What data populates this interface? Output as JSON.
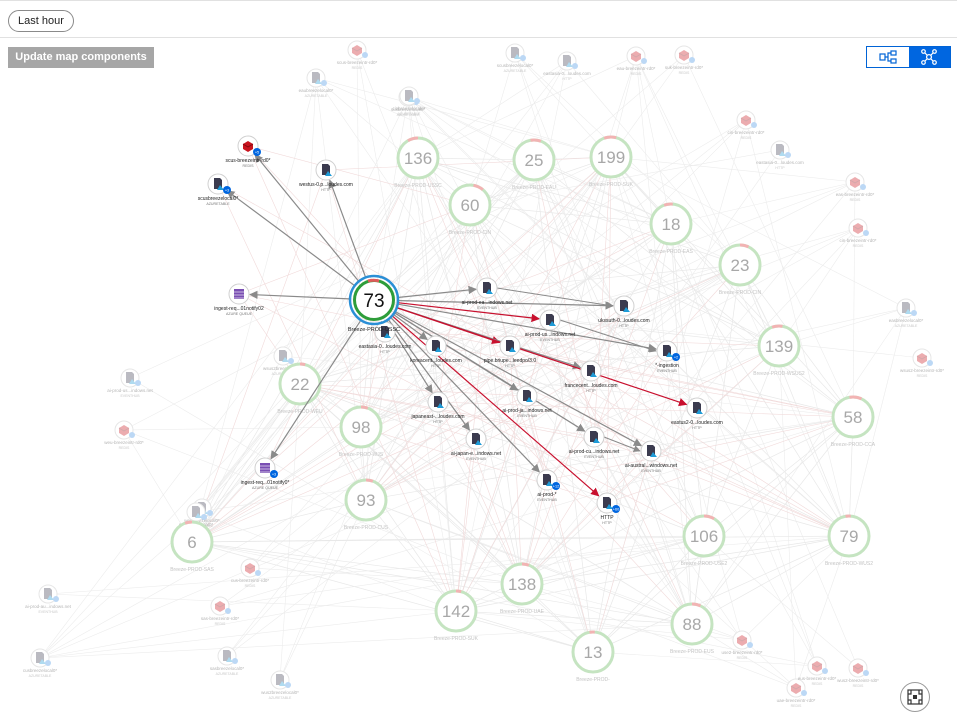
{
  "toolbar": {
    "time_range": "Last hour",
    "update_button": "Update map components"
  },
  "colors": {
    "accent": "#0066e0",
    "healthy": "#2e9d3a",
    "faded_ring": "#c5e4c1",
    "alert_arc": "#e05a5a",
    "error_edge": "#c8102e",
    "edge": "#8a8a8a"
  },
  "focus": {
    "count": "73",
    "label": "Breeze-PROD-USSC"
  },
  "clusters": [
    {
      "count": "136",
      "label": "Breeze-PROD-USSC"
    },
    {
      "count": "25",
      "label": "Breeze-PROD-EAU"
    },
    {
      "count": "199",
      "label": "Breeze-PROD-SUK"
    },
    {
      "count": "60",
      "label": "Breeze-PROD-CIN"
    },
    {
      "count": "18",
      "label": "Breeze-PROD-EAS"
    },
    {
      "count": "23",
      "label": "Breeze-PROD-CIN"
    },
    {
      "count": "139",
      "label": "Breeze-PROD-WSUS2"
    },
    {
      "count": "22",
      "label": "Breeze-PROD-WEU"
    },
    {
      "count": "98",
      "label": "Breeze-PROD-WJS"
    },
    {
      "count": "58",
      "label": "Breeze-PROD-CCA"
    },
    {
      "count": "93",
      "label": "Breeze-PROD-CUS"
    },
    {
      "count": "6",
      "label": "Breeze-PROD-SAS"
    },
    {
      "count": "106",
      "label": "Breeze-PROD-USE2"
    },
    {
      "count": "79",
      "label": "Breeze-PROD-WUS2"
    },
    {
      "count": "138",
      "label": "Breeze-PROD-UAE"
    },
    {
      "count": "142",
      "label": "Breeze-PROD-SUK"
    },
    {
      "count": "88",
      "label": "Breeze-PROD-EUS"
    },
    {
      "count": "13",
      "label": "Breeze-PROD-"
    }
  ],
  "deps": [
    {
      "icon": "redis",
      "badge": "+5",
      "name": "scus-breezeintr-rd0*",
      "type": "REDIS"
    },
    {
      "icon": "doc",
      "badge": "+3",
      "name": "scusbreezelocal0*",
      "type": "AZURETABLE"
    },
    {
      "icon": "doc",
      "badge": "",
      "name": "westus-0.p...loudes.com",
      "type": "HTTP"
    },
    {
      "icon": "queue",
      "badge": "",
      "name": "ingest-req...01notify02",
      "type": "AZURE QUEUE"
    },
    {
      "icon": "doc",
      "badge": "",
      "name": "ai-prod-ea...indows.net",
      "type": "EVENTHUB"
    },
    {
      "icon": "doc",
      "badge": "",
      "name": "ukssuth-0...loudes.com",
      "type": "HTTP"
    },
    {
      "icon": "doc",
      "badge": "",
      "name": "eastasia-0...loudes.com",
      "type": "HTTP"
    },
    {
      "icon": "doc",
      "badge": "",
      "name": "ai-prod-us...indows.net",
      "type": "EVENTHUB"
    },
    {
      "icon": "doc",
      "badge": "+2",
      "name": "*-ingestion",
      "type": "EVENTHUB"
    },
    {
      "icon": "doc",
      "badge": "",
      "name": "koreacent...loudes.com",
      "type": "HTTP"
    },
    {
      "icon": "doc",
      "badge": "",
      "name": "pipe.briupe...leedpo/3.0",
      "type": "HTTP"
    },
    {
      "icon": "doc",
      "badge": "",
      "name": "francecent...loudes.com",
      "type": "HTTP"
    },
    {
      "icon": "doc",
      "badge": "",
      "name": "ai-prod-ja...indows.net",
      "type": "EVENTHUB"
    },
    {
      "icon": "doc",
      "badge": "",
      "name": "japaneast-...loudes.com",
      "type": "HTTP"
    },
    {
      "icon": "doc",
      "badge": "",
      "name": "eastus2-0...loudes.com",
      "type": "HTTP"
    },
    {
      "icon": "doc",
      "badge": "",
      "name": "ai-prod-cu...indows.net",
      "type": "EVENTHUB"
    },
    {
      "icon": "doc",
      "badge": "",
      "name": "ai-japan-e...indows.net",
      "type": "EVENTHUB"
    },
    {
      "icon": "doc",
      "badge": "",
      "name": "ai-austral...windows.net",
      "type": "EVENTHUB"
    },
    {
      "icon": "queue",
      "badge": "+3",
      "name": "ingest-req...01notify0*",
      "type": "AZURE QUEUE"
    },
    {
      "icon": "doc",
      "badge": "+12",
      "name": "ai-prod-*",
      "type": "EVENTHUB"
    },
    {
      "icon": "doc",
      "badge": "+60",
      "name": "HTTP",
      "type": "HTTP"
    }
  ],
  "ghosts": [
    {
      "icon": "redis",
      "name": "scus-breezeintr-rd0*",
      "type": "REDIS"
    },
    {
      "icon": "doc",
      "name": "scusbreezelocal0*",
      "type": "AZURETABLE"
    },
    {
      "icon": "doc",
      "name": "eastasia-0...loudes.com",
      "type": "HTTP"
    },
    {
      "icon": "redis",
      "name": "eau-breezeintr-rd0*",
      "type": "REDIS"
    },
    {
      "icon": "redis",
      "name": "suk-breezeintr-rd0*",
      "type": "REDIS"
    },
    {
      "icon": "doc",
      "name": "eaubreezelocal0*",
      "type": "AZURETABLE"
    },
    {
      "icon": "doc",
      "name": "sukbreezelocal0*",
      "type": "AZURETABLE"
    },
    {
      "icon": "doc",
      "name": "cinbreezelocal0*",
      "type": "AZURETABLE"
    },
    {
      "icon": "redis",
      "name": "cin-breezeintr-rd0*",
      "type": "REDIS"
    },
    {
      "icon": "doc",
      "name": "eastasia-0...loudes.com",
      "type": "HTTP"
    },
    {
      "icon": "redis",
      "name": "eas-breezeintr-rd0*",
      "type": "REDIS"
    },
    {
      "icon": "redis",
      "name": "cin-breezeintr-rd0*",
      "type": "REDIS"
    },
    {
      "icon": "doc",
      "name": "easbreezelocal0*",
      "type": "AZURETABLE"
    },
    {
      "icon": "redis",
      "name": "wsus2-breezeintr-rd0*",
      "type": "REDIS"
    },
    {
      "icon": "doc",
      "name": "wsus2breezelocal0*",
      "type": "AZURETABLE"
    },
    {
      "icon": "doc",
      "name": "ai-prod-us...indows.net",
      "type": "EVENTHUB"
    },
    {
      "icon": "redis",
      "name": "weu-breezeintr-rd0*",
      "type": "REDIS"
    },
    {
      "icon": "doc",
      "name": "weubreezelocal0*",
      "type": "AZURETABLE"
    },
    {
      "icon": "doc",
      "name": "ccabreezelocal0*",
      "type": "AZURETABLE"
    },
    {
      "icon": "doc",
      "name": "ai-prod-au...indows.net",
      "type": "EVENTHUB"
    },
    {
      "icon": "doc",
      "name": "cusbreezelocal0*",
      "type": "AZURETABLE"
    },
    {
      "icon": "redis",
      "name": "cus-breezeintr-rd0*",
      "type": "REDIS"
    },
    {
      "icon": "doc",
      "name": "sasbreezelocal0*",
      "type": "AZURETABLE"
    },
    {
      "icon": "redis",
      "name": "sas-breezeintr-rd0*",
      "type": "REDIS"
    },
    {
      "icon": "redis",
      "name": "use2-breezeintr-rd0*",
      "type": "REDIS"
    },
    {
      "icon": "redis",
      "name": "uae-breezeintr-rd0*",
      "type": "REDIS"
    },
    {
      "icon": "redis",
      "name": "eus-breezeintr-rd0*",
      "type": "REDIS"
    },
    {
      "icon": "redis",
      "name": "wus2-breezeintr-rd0*",
      "type": "REDIS"
    },
    {
      "icon": "doc",
      "name": "wus2breezelocal0*",
      "type": "AZURETABLE"
    }
  ]
}
